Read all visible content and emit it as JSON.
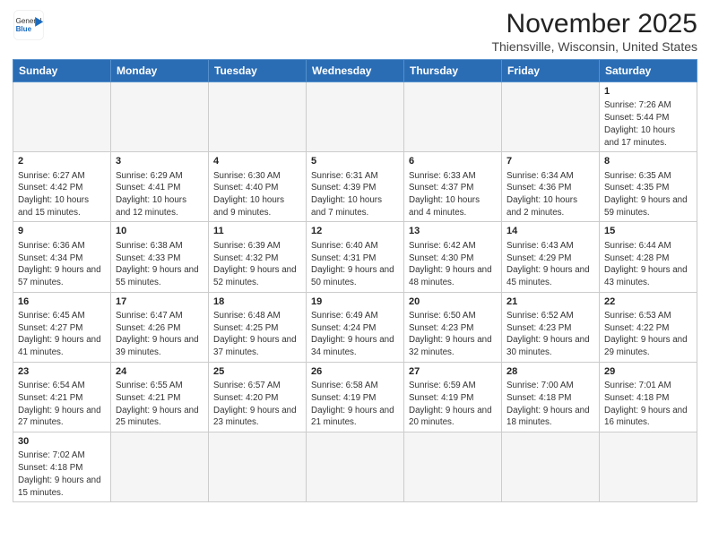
{
  "header": {
    "logo_general": "General",
    "logo_blue": "Blue",
    "title": "November 2025",
    "subtitle": "Thiensville, Wisconsin, United States"
  },
  "weekdays": [
    "Sunday",
    "Monday",
    "Tuesday",
    "Wednesday",
    "Thursday",
    "Friday",
    "Saturday"
  ],
  "weeks": [
    [
      {
        "day": "",
        "info": "",
        "empty": true
      },
      {
        "day": "",
        "info": "",
        "empty": true
      },
      {
        "day": "",
        "info": "",
        "empty": true
      },
      {
        "day": "",
        "info": "",
        "empty": true
      },
      {
        "day": "",
        "info": "",
        "empty": true
      },
      {
        "day": "",
        "info": "",
        "empty": true
      },
      {
        "day": "1",
        "info": "Sunrise: 7:26 AM\nSunset: 5:44 PM\nDaylight: 10 hours and 17 minutes.",
        "empty": false
      }
    ],
    [
      {
        "day": "2",
        "info": "Sunrise: 6:27 AM\nSunset: 4:42 PM\nDaylight: 10 hours and 15 minutes.",
        "empty": false
      },
      {
        "day": "3",
        "info": "Sunrise: 6:29 AM\nSunset: 4:41 PM\nDaylight: 10 hours and 12 minutes.",
        "empty": false
      },
      {
        "day": "4",
        "info": "Sunrise: 6:30 AM\nSunset: 4:40 PM\nDaylight: 10 hours and 9 minutes.",
        "empty": false
      },
      {
        "day": "5",
        "info": "Sunrise: 6:31 AM\nSunset: 4:39 PM\nDaylight: 10 hours and 7 minutes.",
        "empty": false
      },
      {
        "day": "6",
        "info": "Sunrise: 6:33 AM\nSunset: 4:37 PM\nDaylight: 10 hours and 4 minutes.",
        "empty": false
      },
      {
        "day": "7",
        "info": "Sunrise: 6:34 AM\nSunset: 4:36 PM\nDaylight: 10 hours and 2 minutes.",
        "empty": false
      },
      {
        "day": "8",
        "info": "Sunrise: 6:35 AM\nSunset: 4:35 PM\nDaylight: 9 hours and 59 minutes.",
        "empty": false
      }
    ],
    [
      {
        "day": "9",
        "info": "Sunrise: 6:36 AM\nSunset: 4:34 PM\nDaylight: 9 hours and 57 minutes.",
        "empty": false
      },
      {
        "day": "10",
        "info": "Sunrise: 6:38 AM\nSunset: 4:33 PM\nDaylight: 9 hours and 55 minutes.",
        "empty": false
      },
      {
        "day": "11",
        "info": "Sunrise: 6:39 AM\nSunset: 4:32 PM\nDaylight: 9 hours and 52 minutes.",
        "empty": false
      },
      {
        "day": "12",
        "info": "Sunrise: 6:40 AM\nSunset: 4:31 PM\nDaylight: 9 hours and 50 minutes.",
        "empty": false
      },
      {
        "day": "13",
        "info": "Sunrise: 6:42 AM\nSunset: 4:30 PM\nDaylight: 9 hours and 48 minutes.",
        "empty": false
      },
      {
        "day": "14",
        "info": "Sunrise: 6:43 AM\nSunset: 4:29 PM\nDaylight: 9 hours and 45 minutes.",
        "empty": false
      },
      {
        "day": "15",
        "info": "Sunrise: 6:44 AM\nSunset: 4:28 PM\nDaylight: 9 hours and 43 minutes.",
        "empty": false
      }
    ],
    [
      {
        "day": "16",
        "info": "Sunrise: 6:45 AM\nSunset: 4:27 PM\nDaylight: 9 hours and 41 minutes.",
        "empty": false
      },
      {
        "day": "17",
        "info": "Sunrise: 6:47 AM\nSunset: 4:26 PM\nDaylight: 9 hours and 39 minutes.",
        "empty": false
      },
      {
        "day": "18",
        "info": "Sunrise: 6:48 AM\nSunset: 4:25 PM\nDaylight: 9 hours and 37 minutes.",
        "empty": false
      },
      {
        "day": "19",
        "info": "Sunrise: 6:49 AM\nSunset: 4:24 PM\nDaylight: 9 hours and 34 minutes.",
        "empty": false
      },
      {
        "day": "20",
        "info": "Sunrise: 6:50 AM\nSunset: 4:23 PM\nDaylight: 9 hours and 32 minutes.",
        "empty": false
      },
      {
        "day": "21",
        "info": "Sunrise: 6:52 AM\nSunset: 4:23 PM\nDaylight: 9 hours and 30 minutes.",
        "empty": false
      },
      {
        "day": "22",
        "info": "Sunrise: 6:53 AM\nSunset: 4:22 PM\nDaylight: 9 hours and 29 minutes.",
        "empty": false
      }
    ],
    [
      {
        "day": "23",
        "info": "Sunrise: 6:54 AM\nSunset: 4:21 PM\nDaylight: 9 hours and 27 minutes.",
        "empty": false
      },
      {
        "day": "24",
        "info": "Sunrise: 6:55 AM\nSunset: 4:21 PM\nDaylight: 9 hours and 25 minutes.",
        "empty": false
      },
      {
        "day": "25",
        "info": "Sunrise: 6:57 AM\nSunset: 4:20 PM\nDaylight: 9 hours and 23 minutes.",
        "empty": false
      },
      {
        "day": "26",
        "info": "Sunrise: 6:58 AM\nSunset: 4:19 PM\nDaylight: 9 hours and 21 minutes.",
        "empty": false
      },
      {
        "day": "27",
        "info": "Sunrise: 6:59 AM\nSunset: 4:19 PM\nDaylight: 9 hours and 20 minutes.",
        "empty": false
      },
      {
        "day": "28",
        "info": "Sunrise: 7:00 AM\nSunset: 4:18 PM\nDaylight: 9 hours and 18 minutes.",
        "empty": false
      },
      {
        "day": "29",
        "info": "Sunrise: 7:01 AM\nSunset: 4:18 PM\nDaylight: 9 hours and 16 minutes.",
        "empty": false
      }
    ],
    [
      {
        "day": "30",
        "info": "Sunrise: 7:02 AM\nSunset: 4:18 PM\nDaylight: 9 hours and 15 minutes.",
        "empty": false
      },
      {
        "day": "",
        "info": "",
        "empty": true
      },
      {
        "day": "",
        "info": "",
        "empty": true
      },
      {
        "day": "",
        "info": "",
        "empty": true
      },
      {
        "day": "",
        "info": "",
        "empty": true
      },
      {
        "day": "",
        "info": "",
        "empty": true
      },
      {
        "day": "",
        "info": "",
        "empty": true
      }
    ]
  ]
}
